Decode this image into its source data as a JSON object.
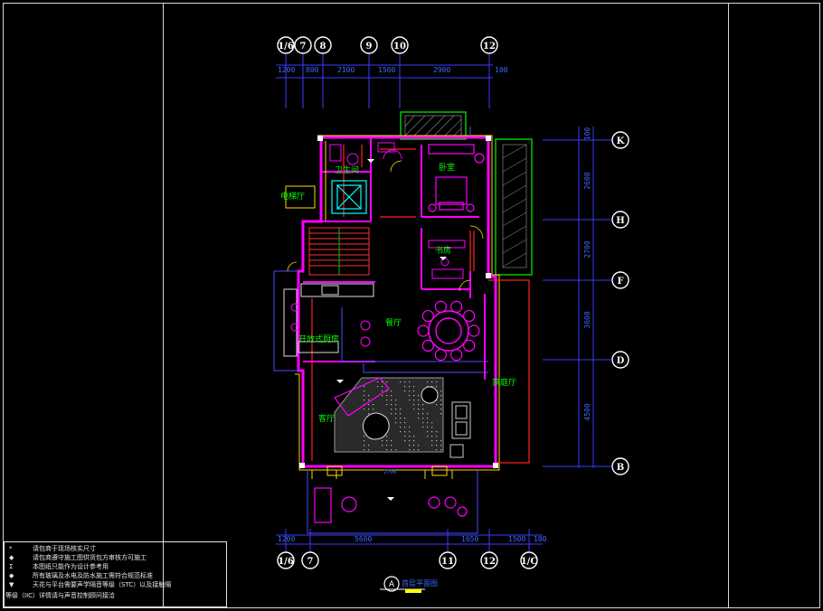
{
  "drawing": {
    "title": "首层平面图",
    "title_marker": "A"
  },
  "axes": {
    "top": [
      "1/6",
      "7",
      "8",
      "9",
      "10",
      "12"
    ],
    "bottom": [
      "1/6",
      "7",
      "11",
      "12",
      "1/C"
    ],
    "right": [
      "K",
      "H",
      "F",
      "D",
      "B"
    ]
  },
  "dimensions": {
    "top": [
      "1200",
      "800",
      "2100",
      "1500",
      "2900",
      "100"
    ],
    "bottom": [
      "1200",
      "5600",
      "1650",
      "1500",
      "100"
    ],
    "right": [
      "100",
      "2600",
      "2700",
      "3600",
      "4500"
    ]
  },
  "rooms": {
    "bath": "卫生间",
    "bedroom": "卧室",
    "elevator": "电梯厅",
    "study": "书房",
    "dining": "餐厅",
    "kitchen": "开放式厨房",
    "family_room": "家庭厅",
    "living": "客厅",
    "dim_inner": "2700"
  },
  "notes": [
    "请包商于现场核实尺寸",
    "请包商遵守施工图供货包方审核方可施工",
    "本图纸只能作为设计参考用",
    "所有玻璃及水电及防水施工需符合规范标准",
    "天花与平台需要声学隔音等级（STC）以及接触隔",
    "等级（IIC）详情请与声音控制顾问接洽"
  ],
  "note_markers": [
    "*",
    "◆",
    "Σ",
    "◆",
    "▼",
    ""
  ],
  "colors": {
    "background": "#000000",
    "wall": "#ff00ff",
    "dimension": "#4444ff",
    "axis_bubble": "#ffffff",
    "furniture": "#ff00ff",
    "text": "#00ff00"
  }
}
